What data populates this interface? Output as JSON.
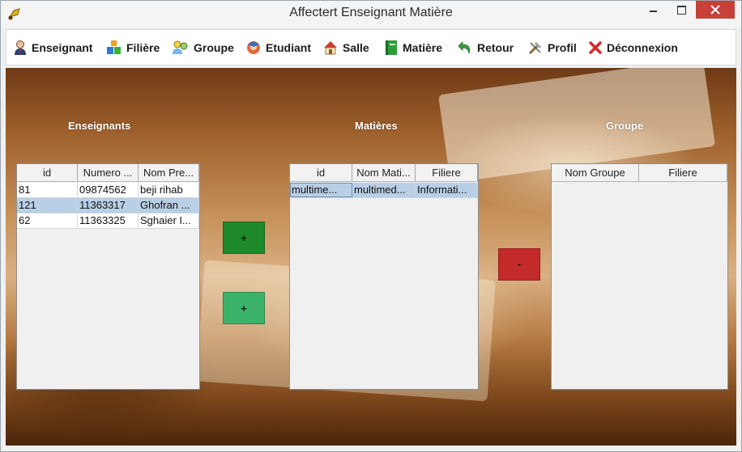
{
  "window": {
    "title": "Affectert Enseignant Matière"
  },
  "menu": {
    "items": [
      {
        "label": "Enseignant",
        "icon": "teacher-icon"
      },
      {
        "label": "Filière",
        "icon": "blocks-icon"
      },
      {
        "label": "Groupe",
        "icon": "group-icon"
      },
      {
        "label": "Etudiant",
        "icon": "student-icon"
      },
      {
        "label": "Salle",
        "icon": "house-icon"
      },
      {
        "label": "Matière",
        "icon": "book-icon"
      },
      {
        "label": "Retour",
        "icon": "return-arrow-icon"
      },
      {
        "label": "Profil",
        "icon": "tools-icon"
      },
      {
        "label": "Déconnexion",
        "icon": "close-x-icon"
      }
    ]
  },
  "sections": {
    "enseignants": "Enseignants",
    "matieres": "Matières",
    "groupe": "Groupe"
  },
  "enseignants_table": {
    "columns": [
      "id",
      "Numero ...",
      "Nom Pre..."
    ],
    "rows": [
      [
        "81",
        "09874562",
        "beji rihab"
      ],
      [
        "121",
        "11363317",
        "Ghofran ..."
      ],
      [
        "62",
        "11363325",
        "Sghaier I..."
      ]
    ],
    "selected_row": 1
  },
  "matieres_table": {
    "columns": [
      "id",
      "Nom Mati...",
      "Filiere"
    ],
    "rows": [
      [
        "multime...",
        "multimed...",
        "Informati..."
      ]
    ],
    "selected_row": 0
  },
  "groupe_table": {
    "columns": [
      "Nom Groupe",
      "Filiere"
    ],
    "rows": []
  },
  "buttons": {
    "add_top": "+",
    "add_bottom": "+",
    "remove": "-"
  },
  "colors": {
    "add_top": "#1f8a2a",
    "add_bottom": "#3cb36a",
    "remove": "#c42a2a",
    "selection": "#b8cfe5",
    "close_button": "#c7403a"
  }
}
